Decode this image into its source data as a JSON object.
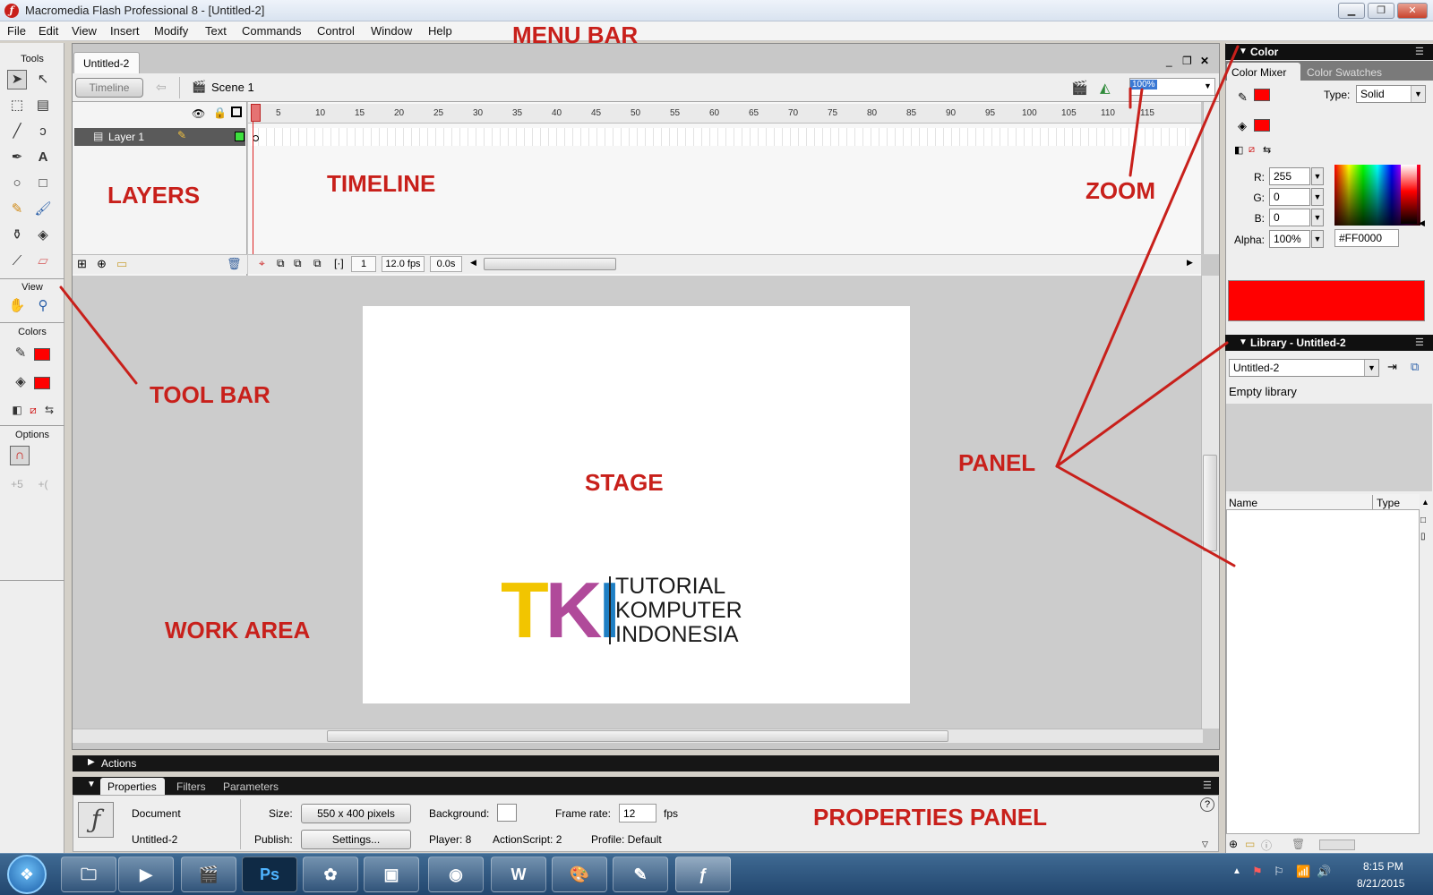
{
  "window": {
    "title": "Macromedia Flash Professional 8 - [Untitled-2]",
    "controls": [
      "▁",
      "❐",
      "✕"
    ]
  },
  "menu": [
    "File",
    "Edit",
    "View",
    "Insert",
    "Modify",
    "Text",
    "Commands",
    "Control",
    "Window",
    "Help"
  ],
  "tools": {
    "header": "Tools",
    "view_label": "View",
    "colors_label": "Colors",
    "options_label": "Options",
    "stroke_color": "#FF0000",
    "fill_color": "#FF0000"
  },
  "document": {
    "tab": "Untitled-2",
    "timeline_button": "Timeline",
    "scene": "Scene 1",
    "zoom": "100%",
    "doc_controls": [
      "_",
      "❐",
      "✕"
    ]
  },
  "timeline": {
    "layer_name": "Layer 1",
    "ruler": [
      "5",
      "10",
      "15",
      "20",
      "25",
      "30",
      "35",
      "40",
      "45",
      "50",
      "55",
      "60",
      "65",
      "70",
      "75",
      "80",
      "85",
      "90",
      "95",
      "100",
      "105",
      "110",
      "115"
    ],
    "current_frame": "1",
    "fps": "12.0 fps",
    "elapsed": "0.0s"
  },
  "stage": {
    "logo_letters": [
      "T",
      "K",
      "I"
    ],
    "logo_lines": [
      "TUTORIAL",
      "KOMPUTER",
      "INDONESIA"
    ]
  },
  "actions": {
    "label": "Actions"
  },
  "properties": {
    "tabs": [
      "Properties",
      "Filters",
      "Parameters"
    ],
    "type": "Document",
    "name": "Untitled-2",
    "size_label": "Size:",
    "size_value": "550 x 400 pixels",
    "background_label": "Background:",
    "framerate_label": "Frame rate:",
    "framerate_value": "12",
    "fps_unit": "fps",
    "publish_label": "Publish:",
    "settings_button": "Settings...",
    "player": "Player: 8",
    "actionscript": "ActionScript:  2",
    "profile": "Profile:  Default"
  },
  "color_panel": {
    "title": "Color",
    "tabs": [
      "Color Mixer",
      "Color Swatches"
    ],
    "type_label": "Type:",
    "type_value": "Solid",
    "r_label": "R:",
    "r": "255",
    "g_label": "G:",
    "g": "0",
    "b_label": "B:",
    "b": "0",
    "alpha_label": "Alpha:",
    "alpha": "100%",
    "hex": "#FF0000"
  },
  "library_panel": {
    "title": "Library - Untitled-2",
    "dropdown": "Untitled-2",
    "status": "Empty library",
    "columns": [
      "Name",
      "Type"
    ]
  },
  "taskbar": {
    "time": "8:15 PM",
    "date": "8/21/2015"
  },
  "annotations": {
    "menu_bar": "MENU BAR",
    "layers": "LAYERS",
    "timeline": "TIMELINE",
    "zoom": "ZOOM",
    "tool_bar": "TOOL BAR",
    "stage": "STAGE",
    "panel": "PANEL",
    "work_area": "WORK AREA",
    "properties_panel": "PROPERTIES PANEL"
  },
  "colors": {
    "annotation": "#C8201B",
    "logo_t": "#F2C500",
    "logo_k": "#B04A9A",
    "logo_i": "#1E7FC4"
  }
}
